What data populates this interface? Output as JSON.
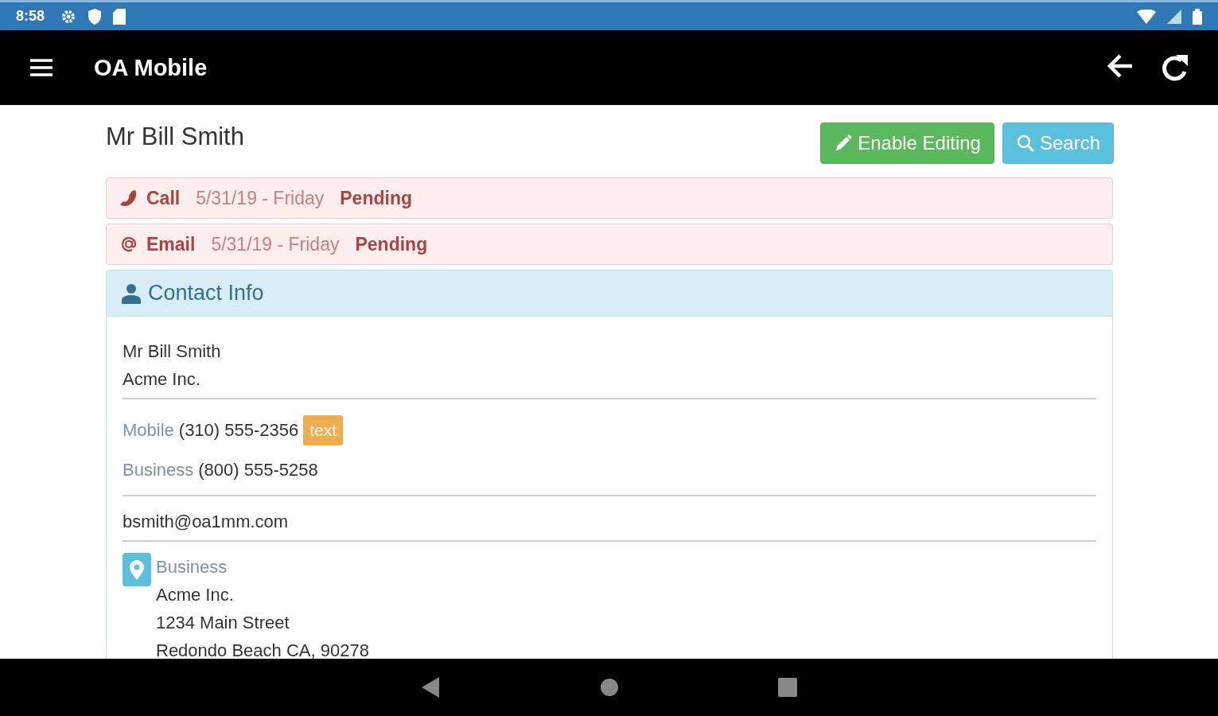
{
  "status_bar": {
    "time": "8:58"
  },
  "app_bar": {
    "title": "OA Mobile"
  },
  "page": {
    "title": "Mr Bill Smith",
    "buttons": [
      {
        "kind": "edit",
        "label": "Enable Editing"
      },
      {
        "kind": "search",
        "label": "Search"
      }
    ]
  },
  "activities": [
    {
      "kind": "call",
      "label": "Call",
      "date": "5/31/19 - Friday",
      "status": "Pending"
    },
    {
      "kind": "email",
      "label": "Email",
      "date": "5/31/19 - Friday",
      "status": "Pending"
    }
  ],
  "contact_info": {
    "heading": "Contact Info",
    "name": "Mr Bill Smith",
    "company": "Acme Inc.",
    "phones": [
      {
        "label": "Mobile",
        "number": "(310) 555-2356",
        "badge": "text"
      },
      {
        "label": "Business",
        "number": "(800) 555-5258"
      }
    ],
    "email": "bsmith@oa1mm.com",
    "address": {
      "label": "Business",
      "lines": [
        "Acme Inc.",
        "1234 Main Street",
        "Redondo Beach CA, 90278"
      ]
    }
  }
}
